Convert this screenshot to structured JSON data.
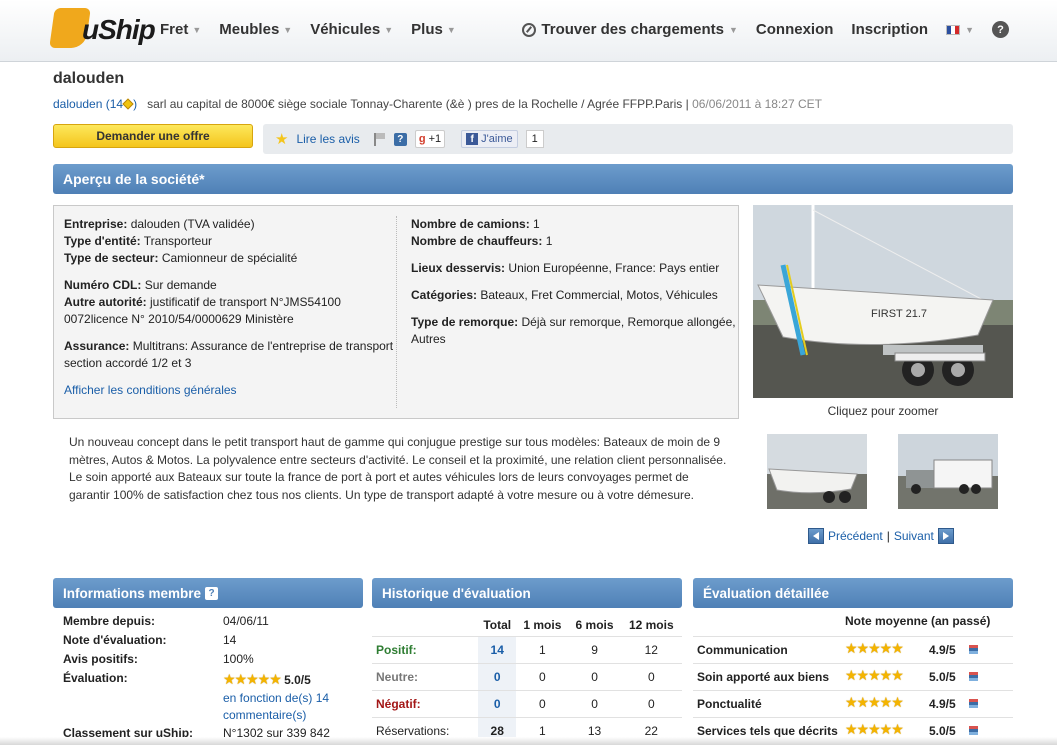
{
  "header": {
    "logo": "uShip",
    "nav": [
      "Fret",
      "Meubles",
      "Véhicules",
      "Plus"
    ],
    "find_loads": "Trouver des chargements",
    "login": "Connexion",
    "signup": "Inscription",
    "help": "?"
  },
  "company": {
    "name": "dalouden",
    "user_link": "dalouden (14",
    "user_link_end": ")",
    "tagline": "sarl au capital de 8000€ siège sociale Tonnay-Charente (&è ) pres de la Rochelle / Agrée FFPP.Paris |",
    "date": "06/06/2011 à 18:27 CET"
  },
  "actions": {
    "request_offer": "Demander une offre",
    "read_reviews": "Lire les avis",
    "gplus": "+1",
    "fb_like": "J'aime",
    "fb_count": "1"
  },
  "overview": {
    "title": "Aperçu de la société*",
    "col1": [
      {
        "k": "Entreprise:",
        "v": "dalouden (TVA validée)"
      },
      {
        "k": "Type d'entité:",
        "v": "Transporteur"
      },
      {
        "k": "Type de secteur:",
        "v": "Camionneur de spécialité"
      },
      {
        "k": "Numéro CDL:",
        "v": "Sur demande"
      },
      {
        "k": "Autre autorité:",
        "v": "justificatif de transport N°JMS54100 0072licence N° 2010/54/0000629 Ministère"
      },
      {
        "k": "Assurance:",
        "v": "Multitrans: Assurance de l'entreprise de transport section accordé 1/2 et 3"
      }
    ],
    "terms_link": "Afficher les conditions générales",
    "col2": [
      {
        "k": "Nombre de camions:",
        "v": "1"
      },
      {
        "k": "Nombre de chauffeurs:",
        "v": "1"
      },
      {
        "k": "Lieux desservis:",
        "v": "Union Européenne, France: Pays entier"
      },
      {
        "k": "Catégories:",
        "v": "Bateaux, Fret Commercial, Motos, Véhicules"
      },
      {
        "k": "Type de remorque:",
        "v": "Déjà sur remorque, Remorque allongée, Autres"
      }
    ],
    "description": "Un nouveau concept dans le petit transport haut de gamme qui conjugue prestige sur tous modèles: Bateaux de moin de 9 mètres, Autos & Motos. La polyvalence entre secteurs d'activité. Le conseil et la proximité, une relation client personnalisée. Le soin apporté aux Bateaux sur toute la france de port à port et autes véhicules lors de leurs convoyages permet de garantir 100% de satisfaction chez tous nos clients. Un type de transport adapté à votre mesure ou à votre démesure.",
    "zoom_caption": "Cliquez pour zoomer",
    "boat_text": "FIRST 21.7",
    "prev": "Précédent",
    "sep": "|",
    "next": "Suivant"
  },
  "member": {
    "title": "Informations membre",
    "rows": [
      {
        "k": "Membre depuis:",
        "v": "04/06/11"
      },
      {
        "k": "Note d'évaluation:",
        "v": "14"
      },
      {
        "k": "Avis positifs:",
        "v": "100%"
      }
    ],
    "rating_label": "Évaluation:",
    "rating_value": "5.0/5",
    "rating_note": "en fonction de(s) 14 commentaire(s)",
    "rank_label": "Classement sur uShip:",
    "rank_value": "N°1302 sur 339 842"
  },
  "history": {
    "title": "Historique d'évaluation",
    "headers": [
      "",
      "Total",
      "1 mois",
      "6 mois",
      "12 mois"
    ],
    "rows": [
      {
        "label": "Positif:",
        "vals": [
          "14",
          "1",
          "9",
          "12"
        ]
      },
      {
        "label": "Neutre:",
        "vals": [
          "0",
          "0",
          "0",
          "0"
        ]
      },
      {
        "label": "Négatif:",
        "vals": [
          "0",
          "0",
          "0",
          "0"
        ]
      },
      {
        "label": "Réservations:",
        "vals": [
          "28",
          "1",
          "13",
          "22"
        ]
      }
    ]
  },
  "detail": {
    "title": "Évaluation détaillée",
    "subtitle": "Note moyenne (an passé)",
    "rows": [
      {
        "k": "Communication",
        "v": "4.9/5"
      },
      {
        "k": "Soin apporté aux biens",
        "v": "5.0/5"
      },
      {
        "k": "Ponctualité",
        "v": "4.9/5"
      },
      {
        "k": "Services tels que décrits",
        "v": "5.0/5"
      }
    ]
  },
  "stars_glyph": "★★★★★",
  "colors": {
    "accent": "#4f80b6",
    "cta": "#f4c51c",
    "link": "#1a5ea8"
  }
}
